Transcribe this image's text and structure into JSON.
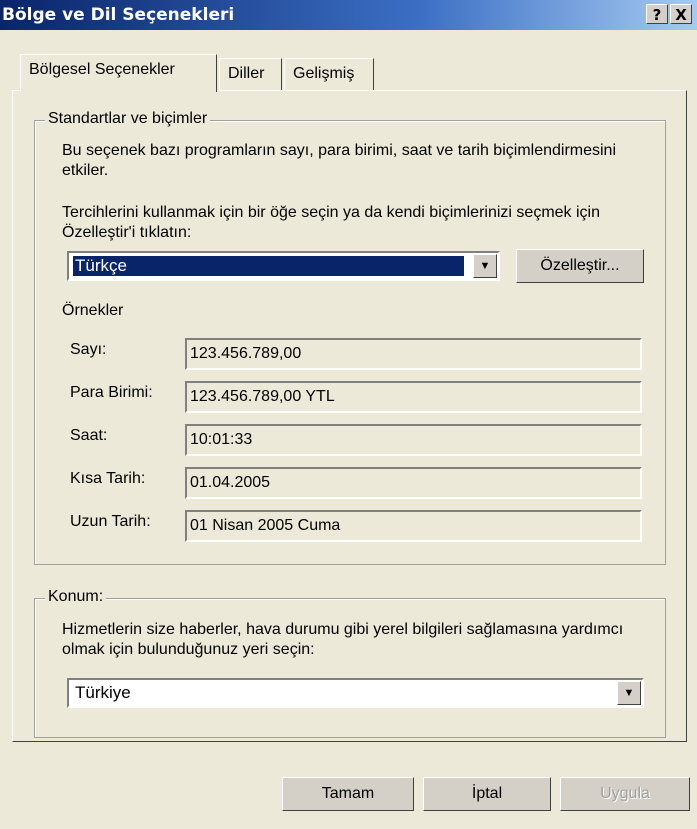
{
  "window": {
    "title": "Bölge ve Dil Seçenekleri",
    "help_label": "?",
    "close_label": "X"
  },
  "tabs": [
    {
      "label": "Bölgesel Seçenekler",
      "active": true
    },
    {
      "label": "Diller",
      "active": false
    },
    {
      "label": "Gelişmiş",
      "active": false
    }
  ],
  "standards": {
    "legend": "Standartlar ve biçimler",
    "description": "Bu seçenek bazı programların sayı, para birimi, saat ve tarih biçimlendirmesini etkiler.",
    "instruction": "Tercihlerini kullanmak için bir öğe seçin ya da kendi biçimlerinizi seçmek için Özelleştir'i tıklatın:",
    "locale_value": "Türkçe",
    "customize_label": "Özelleştir...",
    "examples_title": "Örnekler",
    "examples": [
      {
        "label": "Sayı:",
        "value": "123.456.789,00"
      },
      {
        "label": "Para Birimi:",
        "value": "123.456.789,00 YTL"
      },
      {
        "label": "Saat:",
        "value": "10:01:33"
      },
      {
        "label": "Kısa Tarih:",
        "value": "01.04.2005"
      },
      {
        "label": "Uzun Tarih:",
        "value": "01 Nisan 2005 Cuma"
      }
    ]
  },
  "location": {
    "legend": "Konum:",
    "description": "Hizmetlerin size haberler, hava durumu gibi yerel bilgileri sağlamasına yardımcı olmak için bulunduğunuz yeri seçin:",
    "value": "Türkiye"
  },
  "buttons": {
    "ok": "Tamam",
    "cancel": "İptal",
    "apply": "Uygula"
  },
  "icons": {
    "dropdown": "chevron-down-icon"
  }
}
